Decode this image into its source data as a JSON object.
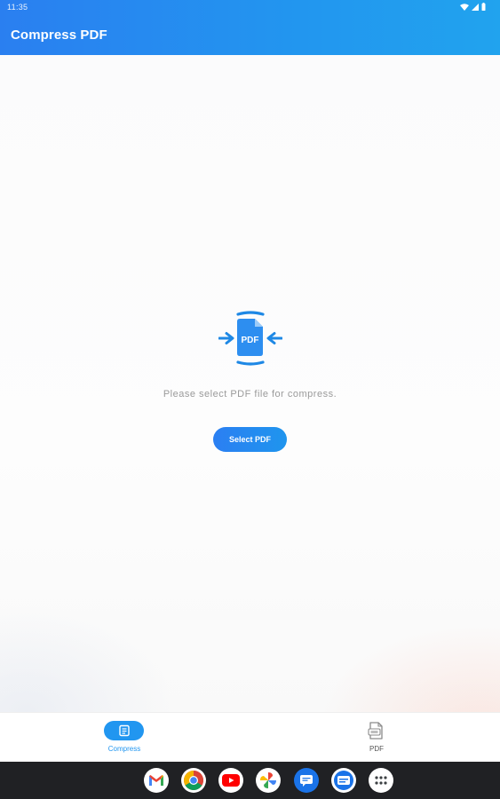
{
  "status_bar": {
    "time": "11:35"
  },
  "app_bar": {
    "title": "Compress PDF"
  },
  "illustration": {
    "label": "PDF"
  },
  "main": {
    "empty_message": "Please select PDF file for compress.",
    "select_button_label": "Select PDF"
  },
  "bottom_nav": {
    "items": [
      {
        "label": "Compress",
        "icon": "compress-icon",
        "active": true
      },
      {
        "label": "PDF",
        "icon": "pdf-file-icon",
        "active": false
      }
    ]
  },
  "taskbar": {
    "apps": [
      "gmail-icon",
      "chrome-icon",
      "youtube-icon",
      "photos-icon",
      "messages-icon",
      "files-icon",
      "app-drawer-icon"
    ]
  },
  "colors": {
    "accent": "#2196F0",
    "header_start": "#2A7FF0",
    "header_end": "#21A3EE"
  }
}
